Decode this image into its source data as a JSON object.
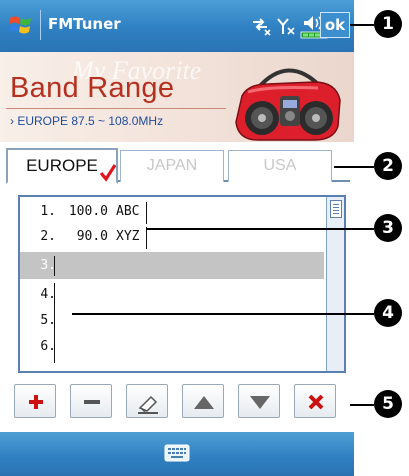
{
  "titlebar": {
    "title": "FMTuner",
    "ok_label": "ok",
    "icons": [
      "windows-start-icon",
      "connectivity-icon",
      "signal-icon",
      "volume-icon",
      "battery-icon"
    ]
  },
  "banner": {
    "watermark": "My Favorite",
    "title": "Band Range",
    "subtitle": "› EUROPE 87.5 ~ 108.0MHz"
  },
  "tabs": [
    {
      "label": "EUROPE",
      "active": true
    },
    {
      "label": "JAPAN",
      "active": false
    },
    {
      "label": "USA",
      "active": false
    }
  ],
  "list": {
    "rows": [
      {
        "num": "1.",
        "freq": "100.0",
        "name": "ABC",
        "selected": false
      },
      {
        "num": "2.",
        "freq": "90.0",
        "name": "XYZ",
        "selected": false
      },
      {
        "num": "3.",
        "freq": "",
        "name": "",
        "selected": true
      },
      {
        "num": "4.",
        "freq": "",
        "name": "",
        "selected": false
      },
      {
        "num": "5.",
        "freq": "",
        "name": "",
        "selected": false
      },
      {
        "num": "6.",
        "freq": "",
        "name": "",
        "selected": false
      }
    ]
  },
  "toolbar": {
    "buttons": [
      "add-icon",
      "remove-icon",
      "edit-icon",
      "move-up-icon",
      "move-down-icon",
      "delete-all-icon"
    ]
  },
  "callouts": [
    "1",
    "2",
    "3",
    "4",
    "5"
  ],
  "colors": {
    "titlebar": "#2f80c2",
    "banner_title": "#b5301f",
    "banner_sub": "#1f4b9e",
    "selected_row": "#c4c4c4",
    "add": "#cc1111",
    "delete": "#cc1111"
  }
}
